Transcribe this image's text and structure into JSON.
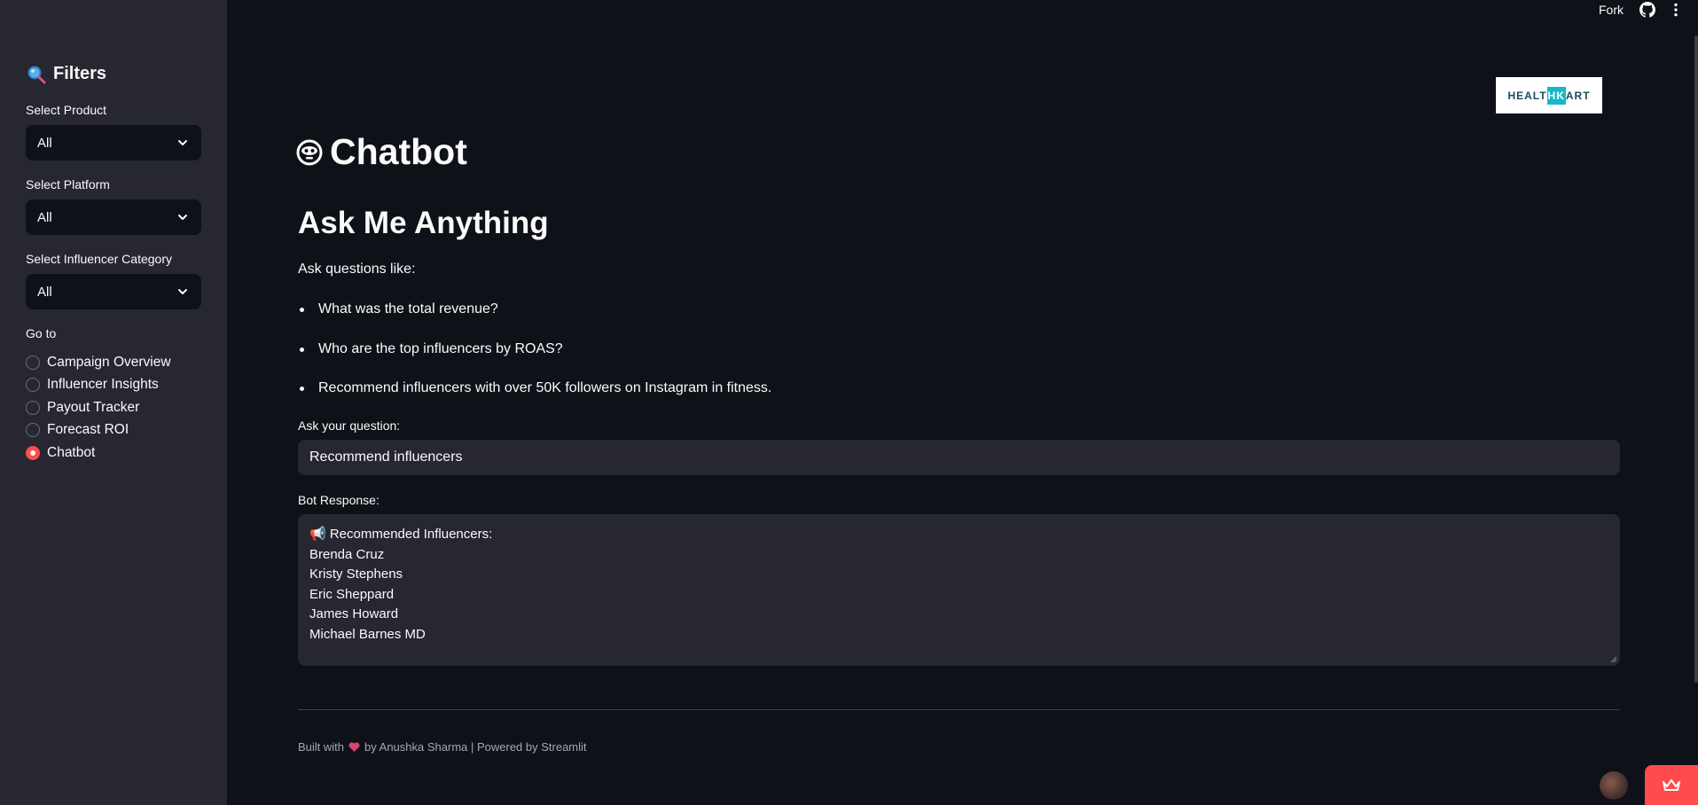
{
  "header": {
    "fork_label": "Fork",
    "github_icon": "github-icon",
    "menu_icon": "kebab-menu-icon"
  },
  "sidebar": {
    "title": "Filters",
    "title_icon": "magnifier-icon",
    "filters": [
      {
        "label": "Select Product",
        "value": "All"
      },
      {
        "label": "Select Platform",
        "value": "All"
      },
      {
        "label": "Select Influencer Category",
        "value": "All"
      }
    ],
    "goto_label": "Go to",
    "nav": [
      {
        "label": "Campaign Overview",
        "selected": false
      },
      {
        "label": "Influencer Insights",
        "selected": false
      },
      {
        "label": "Payout Tracker",
        "selected": false
      },
      {
        "label": "Forecast ROI",
        "selected": false
      },
      {
        "label": "Chatbot",
        "selected": true
      }
    ]
  },
  "logo": {
    "left": "HEALT",
    "mid": "HK",
    "right": "ART"
  },
  "main": {
    "title": "Chatbot",
    "title_icon": "robot-face-icon",
    "heading": "Ask Me Anything",
    "intro": "Ask questions like:",
    "examples": [
      "What was the total revenue?",
      "Who are the top influencers by ROAS?",
      "Recommend influencers with over 50K followers on Instagram in fitness."
    ],
    "question_label": "Ask your question:",
    "question_value": "Recommend influencers",
    "response_label": "Bot Response:",
    "response_lines": [
      "📢 Recommended Influencers:",
      "Brenda Cruz",
      "Kristy Stephens",
      "Eric Sheppard",
      "James Howard",
      "Michael Barnes MD"
    ]
  },
  "footer": {
    "prefix": "Built with",
    "suffix": "by Anushka Sharma | Powered by Streamlit"
  },
  "colors": {
    "background": "#0e1117",
    "sidebar": "#262730",
    "accent": "#ff4b4b"
  }
}
